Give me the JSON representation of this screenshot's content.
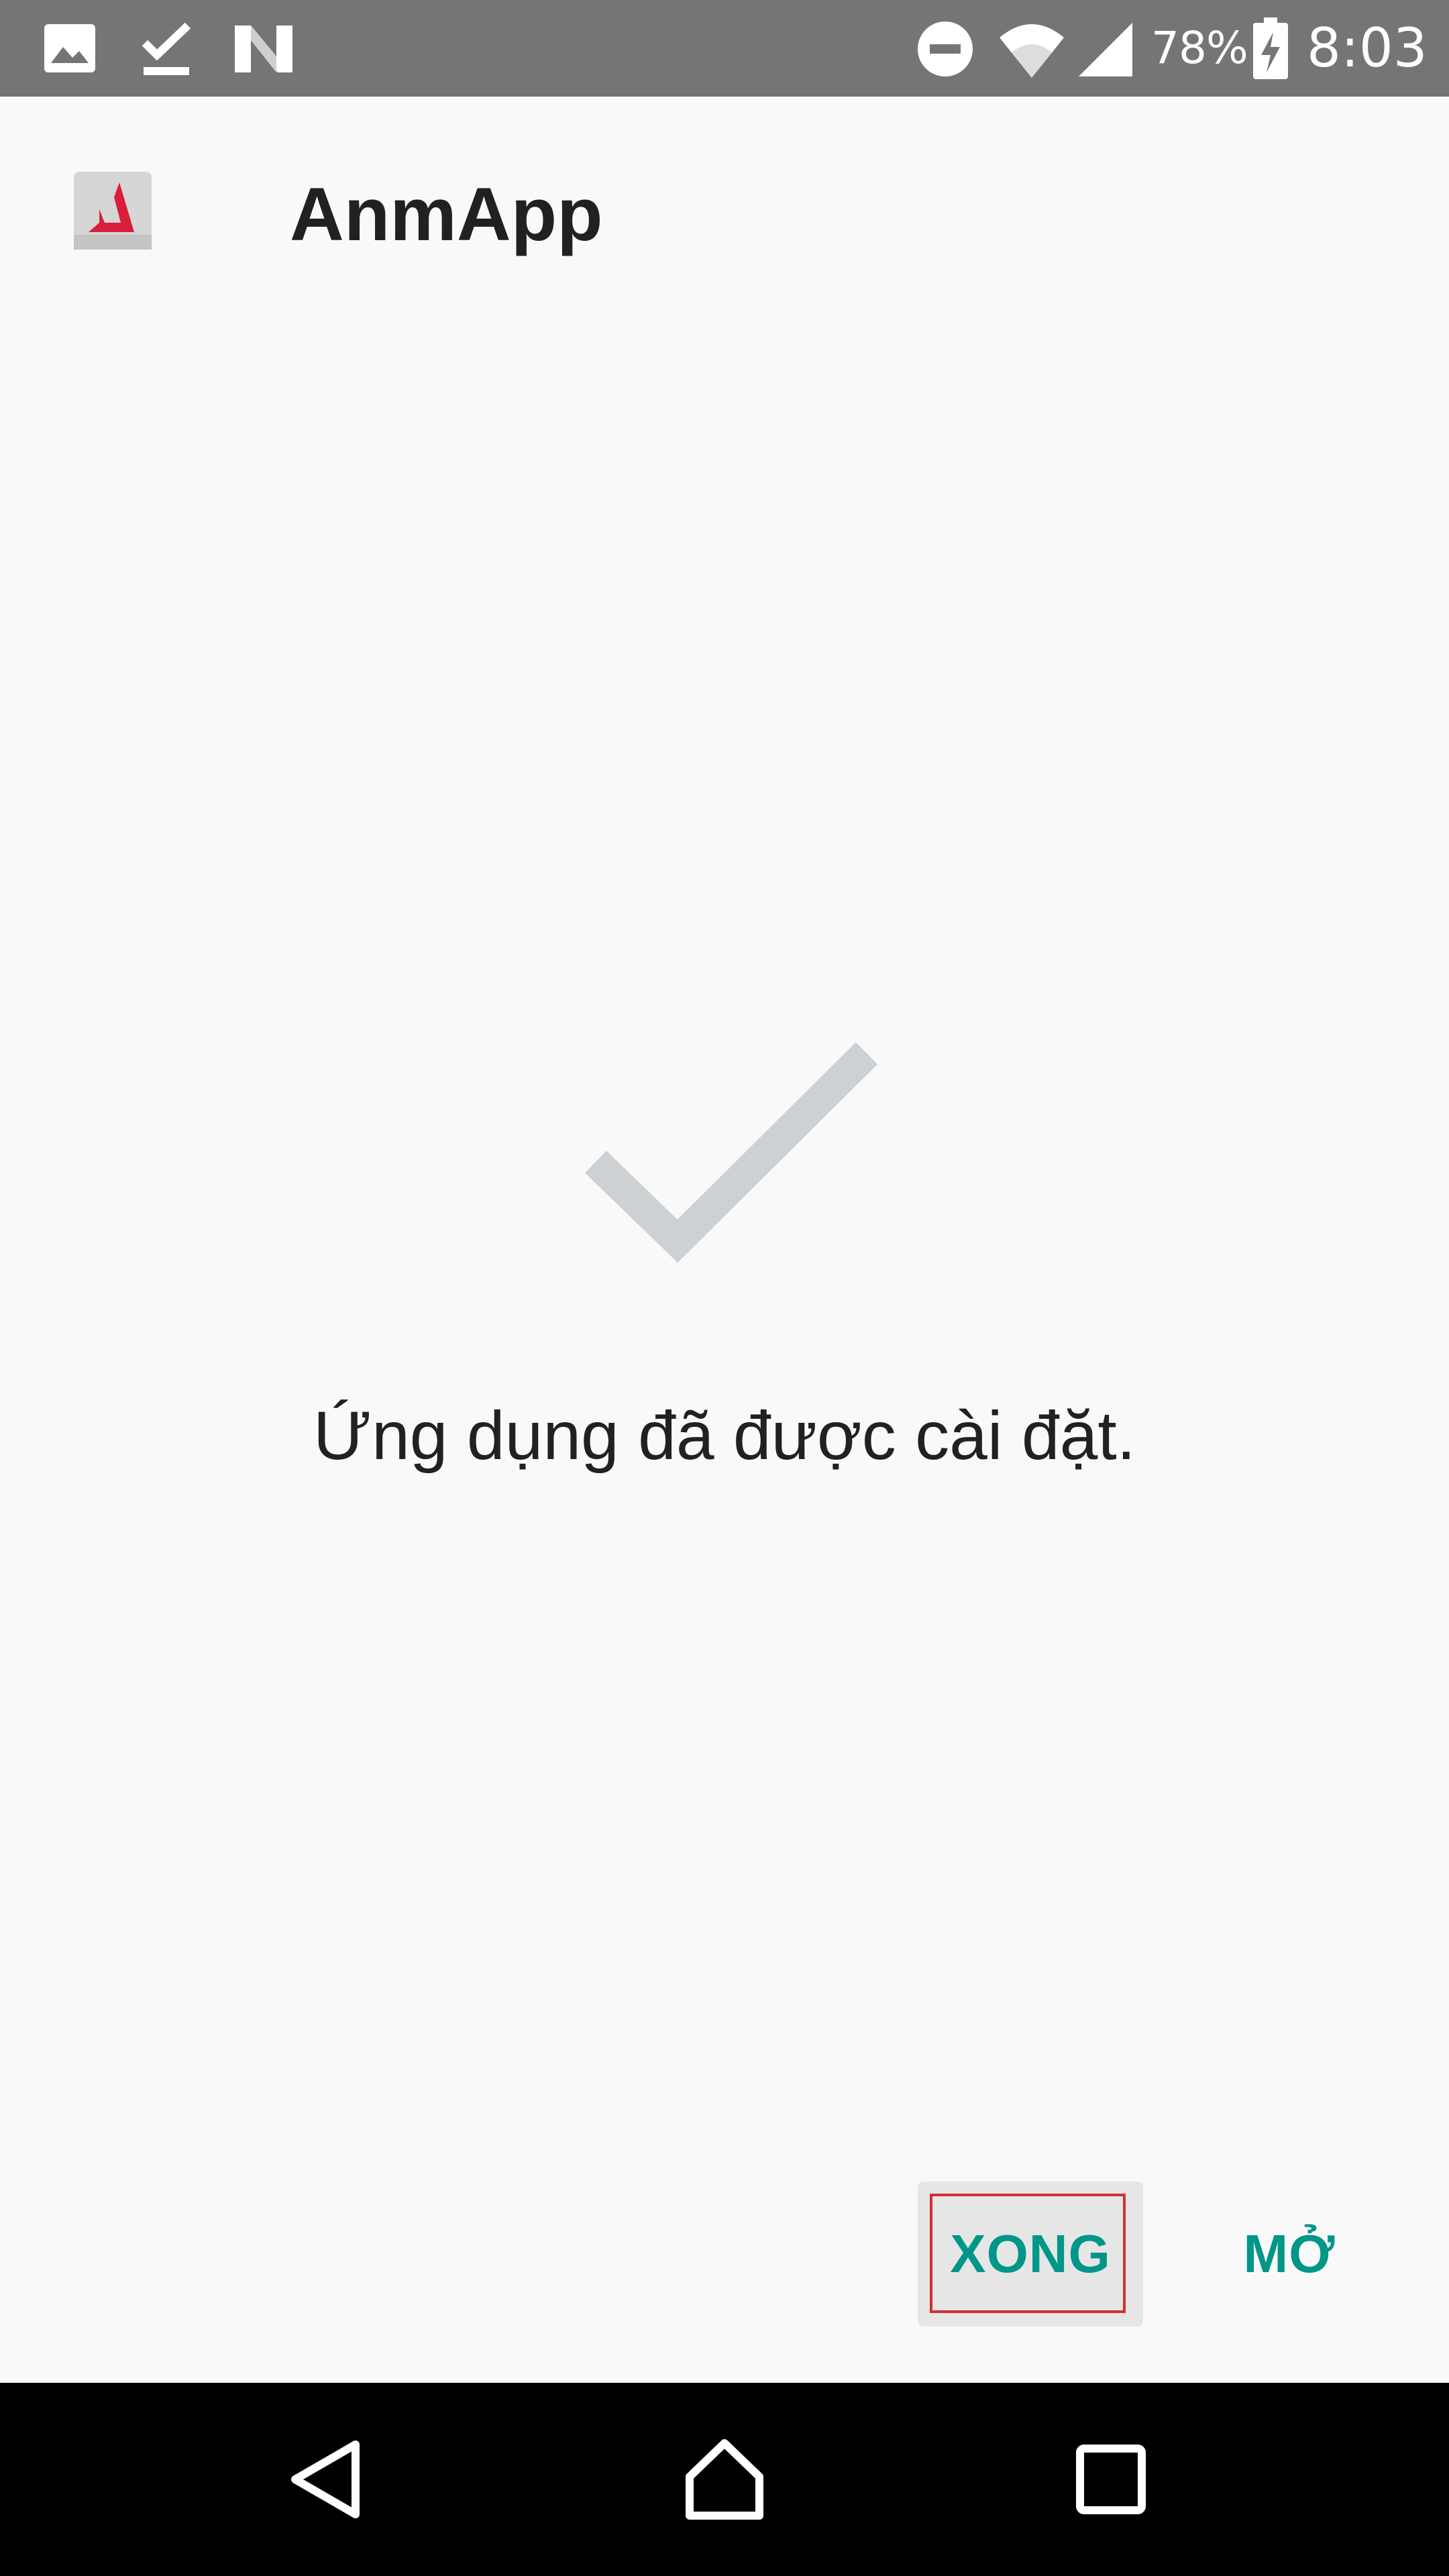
{
  "status_bar": {
    "left_icons": [
      "image-icon",
      "download-done-icon",
      "n-logo-icon"
    ],
    "right_icons": [
      "do-not-disturb-icon",
      "wifi-icon",
      "cell-signal-icon",
      "battery-charging-icon"
    ],
    "battery_percent": "78%",
    "time": "8:03"
  },
  "header": {
    "app_name": "AnmApp",
    "app_icon": "anmapp-logo-icon"
  },
  "main": {
    "status_icon": "checkmark-icon",
    "message": "Ứng dụng đã được cài đặt."
  },
  "actions": {
    "done_label": "XONG",
    "open_label": "MỞ"
  },
  "nav_bar": {
    "icons": [
      "back-icon",
      "home-icon",
      "recents-icon"
    ]
  },
  "colors": {
    "status_bar_bg": "#757575",
    "page_bg": "#f9f9f9",
    "accent": "#009688",
    "checkmark": "#ced1d3",
    "focus_ring": "#d32f2f",
    "nav_bar_bg": "#000000",
    "logo_red": "#d81e3a"
  }
}
